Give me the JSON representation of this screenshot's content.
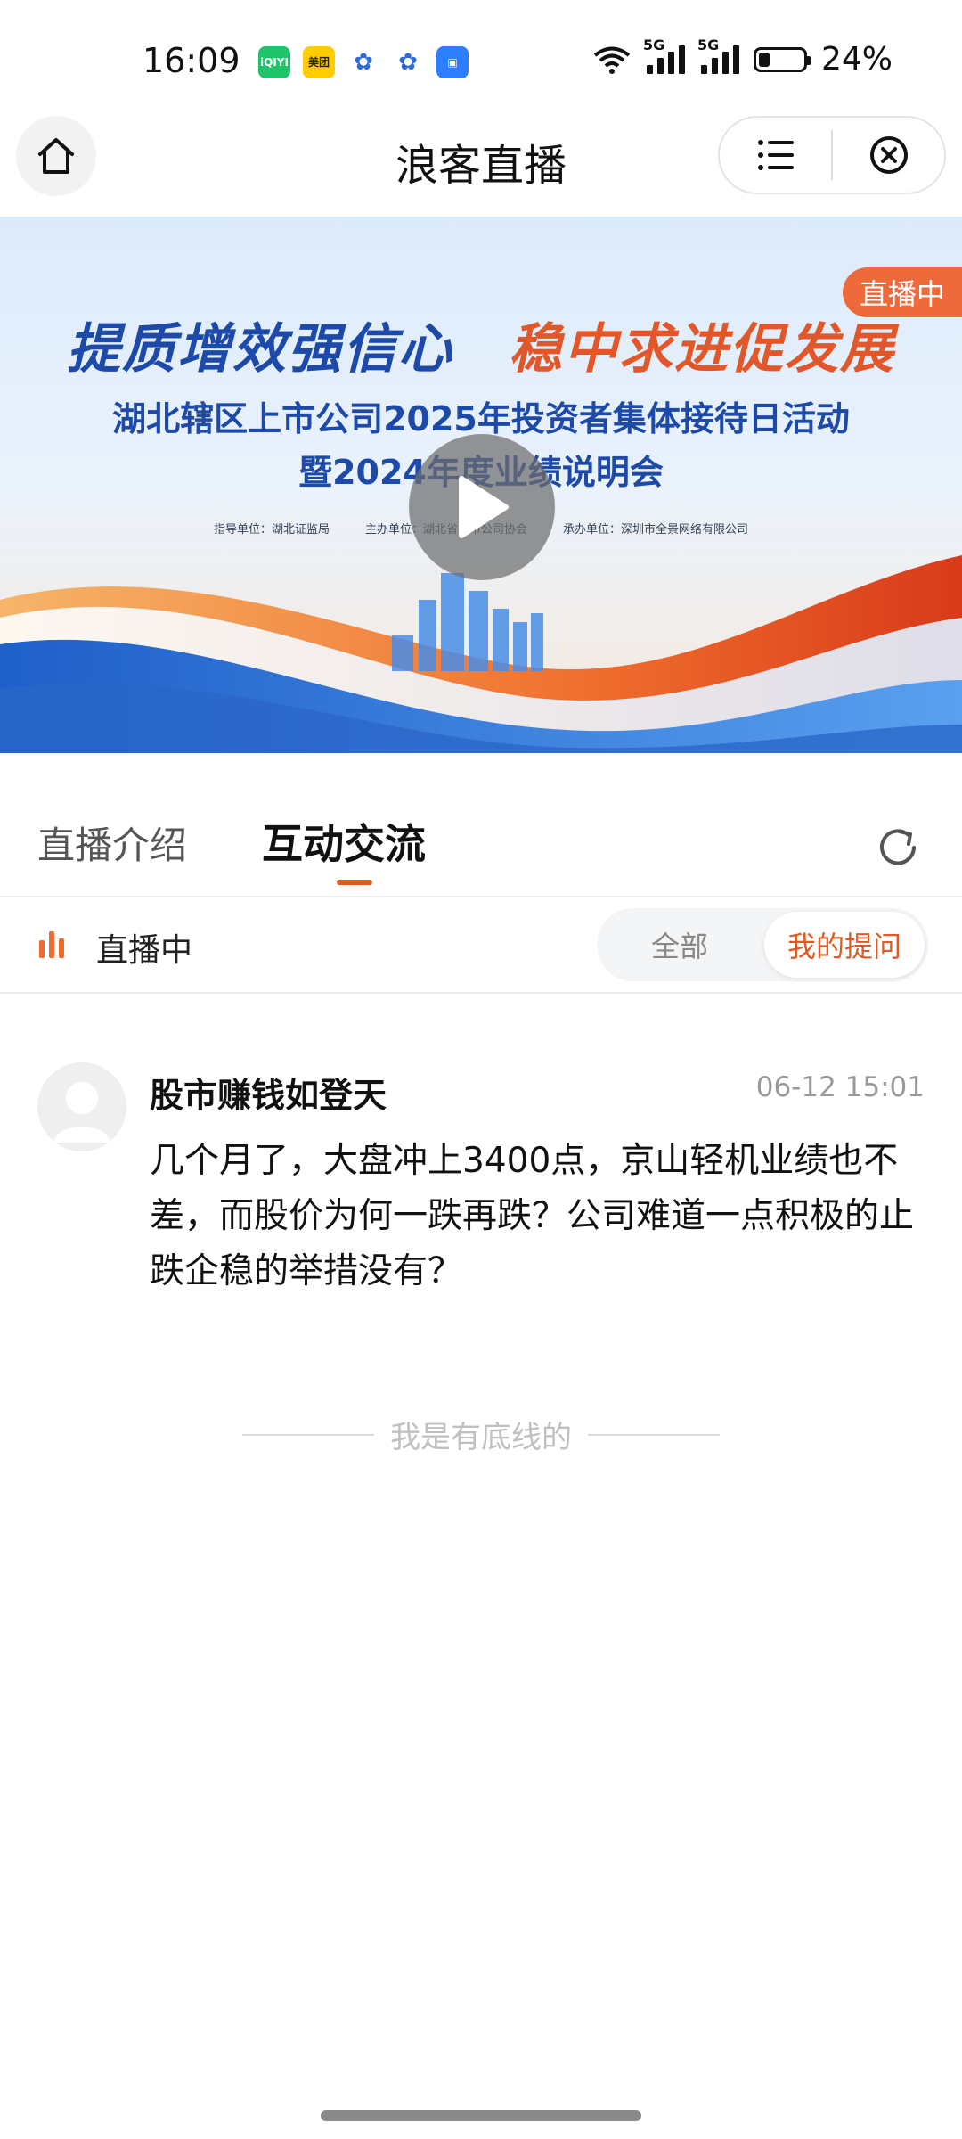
{
  "status_bar": {
    "time": "16:09",
    "apps": [
      {
        "name": "iqiyi-icon",
        "label": "iQIYI"
      },
      {
        "name": "meituan-icon",
        "label": "美团"
      },
      {
        "name": "baidu-icon",
        "label": "du"
      },
      {
        "name": "baidu-alt-icon",
        "label": "du"
      },
      {
        "name": "app-icon",
        "label": ""
      }
    ],
    "signal_1": "5G",
    "signal_2": "5G",
    "battery_level": 0.24,
    "battery_text": "24%"
  },
  "header": {
    "title": "浪客直播"
  },
  "banner": {
    "slogan_left": "提质增效强信心",
    "slogan_right": "稳中求进促发展",
    "line1": "湖北辖区上市公司2025年投资者集体接待日活动",
    "line2": "暨2024年度业绩说明会",
    "org1": "指导单位：湖北证监局",
    "org2": "主办单位：湖北省上市公司协会",
    "org3": "承办单位：深圳市全景网络有限公司",
    "live_badge": "直播中"
  },
  "tabs": {
    "intro": "直播介绍",
    "interact": "互动交流",
    "active": "互动交流"
  },
  "filter": {
    "live_text": "直播中",
    "all": "全部",
    "mine": "我的提问",
    "selected": "我的提问"
  },
  "question": {
    "user": "股市赚钱如登天",
    "time": "06-12 15:01",
    "text": "几个月了，大盘冲上3400点，京山轻机业绩也不差，而股价为何一跌再跌？公司难道一点积极的止跌企稳的举措没有？"
  },
  "footer_text": "我是有底线的",
  "colors": {
    "accent": "#e05a22",
    "live_badge": "#ee6a3b",
    "banner_blue": "#1d4aa8"
  }
}
